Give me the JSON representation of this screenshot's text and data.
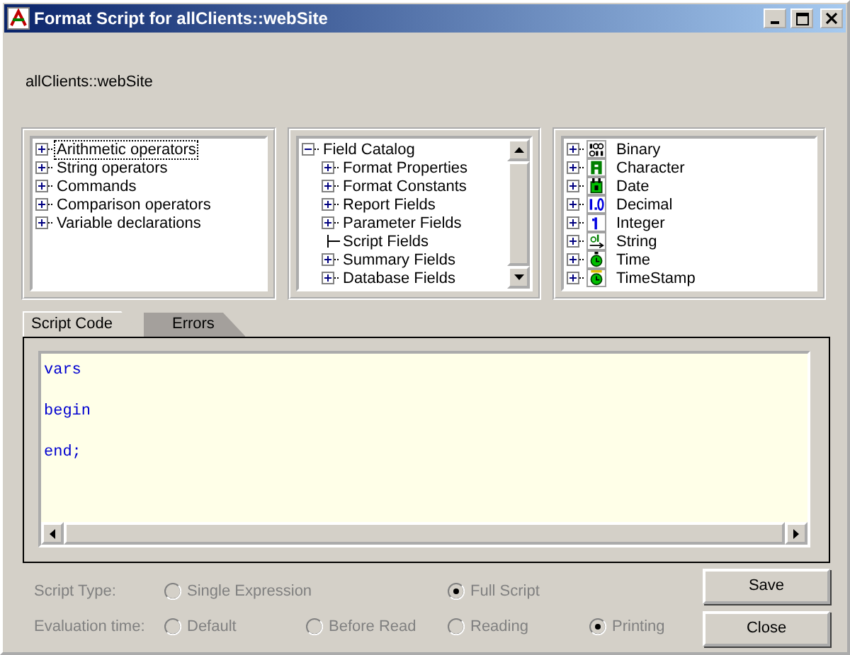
{
  "window": {
    "title": "Format Script for allClients::webSite"
  },
  "path_label": "allClients::webSite",
  "trees": [
    {
      "scrollbar": false,
      "items": [
        {
          "label": "Arithmetic operators",
          "expandable": true,
          "expanded": false,
          "selected": true
        },
        {
          "label": "String operators",
          "expandable": true,
          "expanded": false,
          "selected": false
        },
        {
          "label": "Commands",
          "expandable": true,
          "expanded": false,
          "selected": false
        },
        {
          "label": "Comparison operators",
          "expandable": true,
          "expanded": false,
          "selected": false
        },
        {
          "label": "Variable declarations",
          "expandable": true,
          "expanded": false,
          "selected": false
        }
      ]
    },
    {
      "scrollbar": true,
      "items": [
        {
          "label": "Field Catalog",
          "expandable": true,
          "expanded": true,
          "selected": false,
          "children": [
            {
              "label": "Format Properties",
              "expandable": true,
              "expanded": false,
              "selected": false
            },
            {
              "label": "Format Constants",
              "expandable": true,
              "expanded": false,
              "selected": false
            },
            {
              "label": "Report Fields",
              "expandable": true,
              "expanded": false,
              "selected": false
            },
            {
              "label": "Parameter Fields",
              "expandable": true,
              "expanded": false,
              "selected": false
            },
            {
              "label": "Script Fields",
              "expandable": false,
              "selected": false
            },
            {
              "label": "Summary Fields",
              "expandable": true,
              "expanded": false,
              "selected": false
            },
            {
              "label": "Database Fields",
              "expandable": true,
              "expanded": false,
              "selected": false
            }
          ]
        }
      ]
    },
    {
      "scrollbar": false,
      "items": [
        {
          "label": "Binary",
          "kind": "binary",
          "expandable": true,
          "expanded": false,
          "selected": false
        },
        {
          "label": "Character",
          "kind": "character",
          "expandable": true,
          "expanded": false,
          "selected": false
        },
        {
          "label": "Date",
          "kind": "date",
          "expandable": true,
          "expanded": false,
          "selected": false
        },
        {
          "label": "Decimal",
          "kind": "decimal",
          "expandable": true,
          "expanded": false,
          "selected": false
        },
        {
          "label": "Integer",
          "kind": "integer",
          "expandable": true,
          "expanded": false,
          "selected": false
        },
        {
          "label": "String",
          "kind": "string",
          "expandable": true,
          "expanded": false,
          "selected": false
        },
        {
          "label": "Time",
          "kind": "time",
          "expandable": true,
          "expanded": false,
          "selected": false
        },
        {
          "label": "TimeStamp",
          "kind": "timestamp",
          "expandable": true,
          "expanded": false,
          "selected": false
        }
      ]
    }
  ],
  "tabs": [
    {
      "label": "Script Code",
      "selected": true
    },
    {
      "label": "Errors",
      "selected": false
    }
  ],
  "code_lines": [
    "vars",
    "begin",
    "end;"
  ],
  "option_groups": [
    {
      "label": "Script Type:",
      "disabled": true,
      "options": [
        {
          "label": "Single Expression",
          "selected": false
        },
        {
          "label": "Full Script",
          "selected": true
        }
      ]
    },
    {
      "label": "Evaluation time:",
      "disabled": true,
      "options": [
        {
          "label": "Default",
          "selected": false
        },
        {
          "label": "Before Read",
          "selected": false
        },
        {
          "label": "Reading",
          "selected": false
        },
        {
          "label": "Printing",
          "selected": true
        }
      ]
    }
  ],
  "buttons": [
    "Save",
    "Close"
  ]
}
